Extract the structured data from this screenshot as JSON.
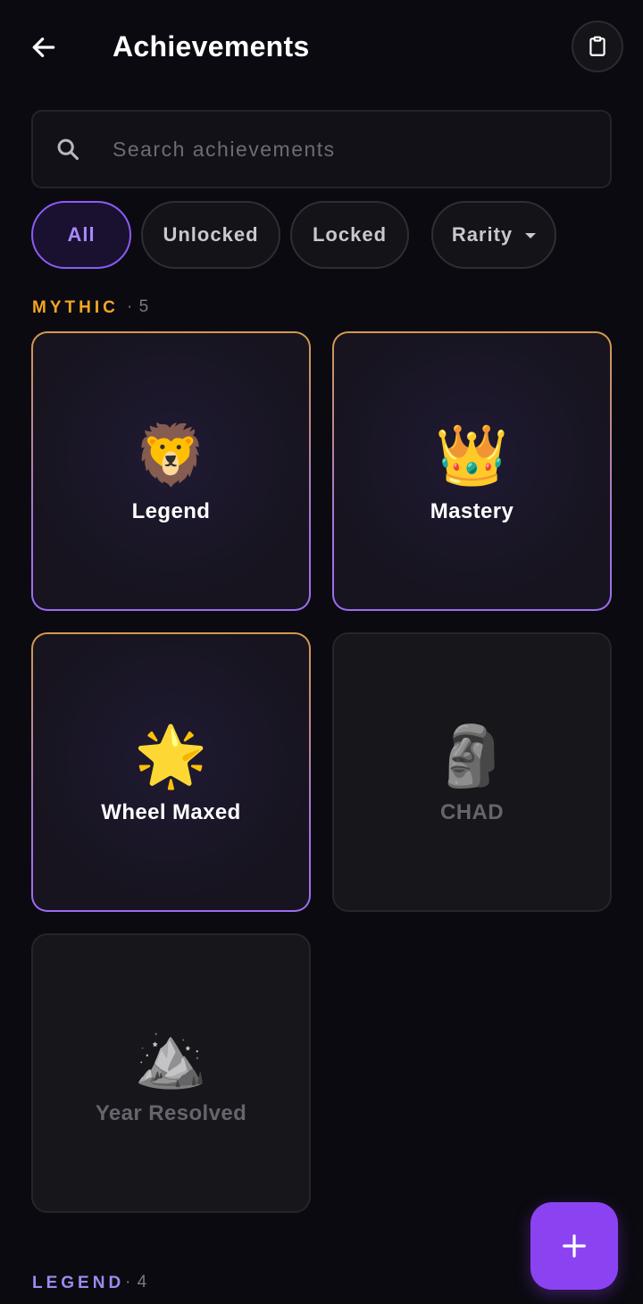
{
  "header": {
    "title": "Achievements",
    "back_icon": "arrow-left-icon",
    "clipboard_icon": "clipboard-icon"
  },
  "search": {
    "placeholder": "Search achievements",
    "value": "",
    "icon": "search-icon"
  },
  "filters": [
    {
      "label": "All",
      "active": true
    },
    {
      "label": "Unlocked",
      "active": false
    },
    {
      "label": "Locked",
      "active": false
    },
    {
      "label": "Rarity",
      "active": false,
      "icon": "caret-down-icon"
    }
  ],
  "sections": [
    {
      "label": "MYTHIC",
      "count": "· 5",
      "color": "#f5a623",
      "achievements": [
        {
          "name": "Legend",
          "emoji": "🦁",
          "unlocked": true
        },
        {
          "name": "Mastery",
          "emoji": "👑",
          "unlocked": true
        },
        {
          "name": "Wheel Maxed",
          "emoji": "🌟",
          "unlocked": true
        },
        {
          "name": "CHAD",
          "emoji": "🗿",
          "unlocked": false
        },
        {
          "name": "Year Resolved",
          "emoji": "🏔️",
          "unlocked": false
        }
      ]
    },
    {
      "label": "LEGEND",
      "count": "· 4",
      "color": "#9b8cf0",
      "achievements": []
    }
  ],
  "fab": {
    "icon": "plus-icon",
    "color": "#8b43f2"
  },
  "colors": {
    "background": "#0b0a10",
    "accent": "#8b5cf6",
    "card_border_top": "#d39a4a",
    "card_border_bottom": "#9d6cf3"
  }
}
